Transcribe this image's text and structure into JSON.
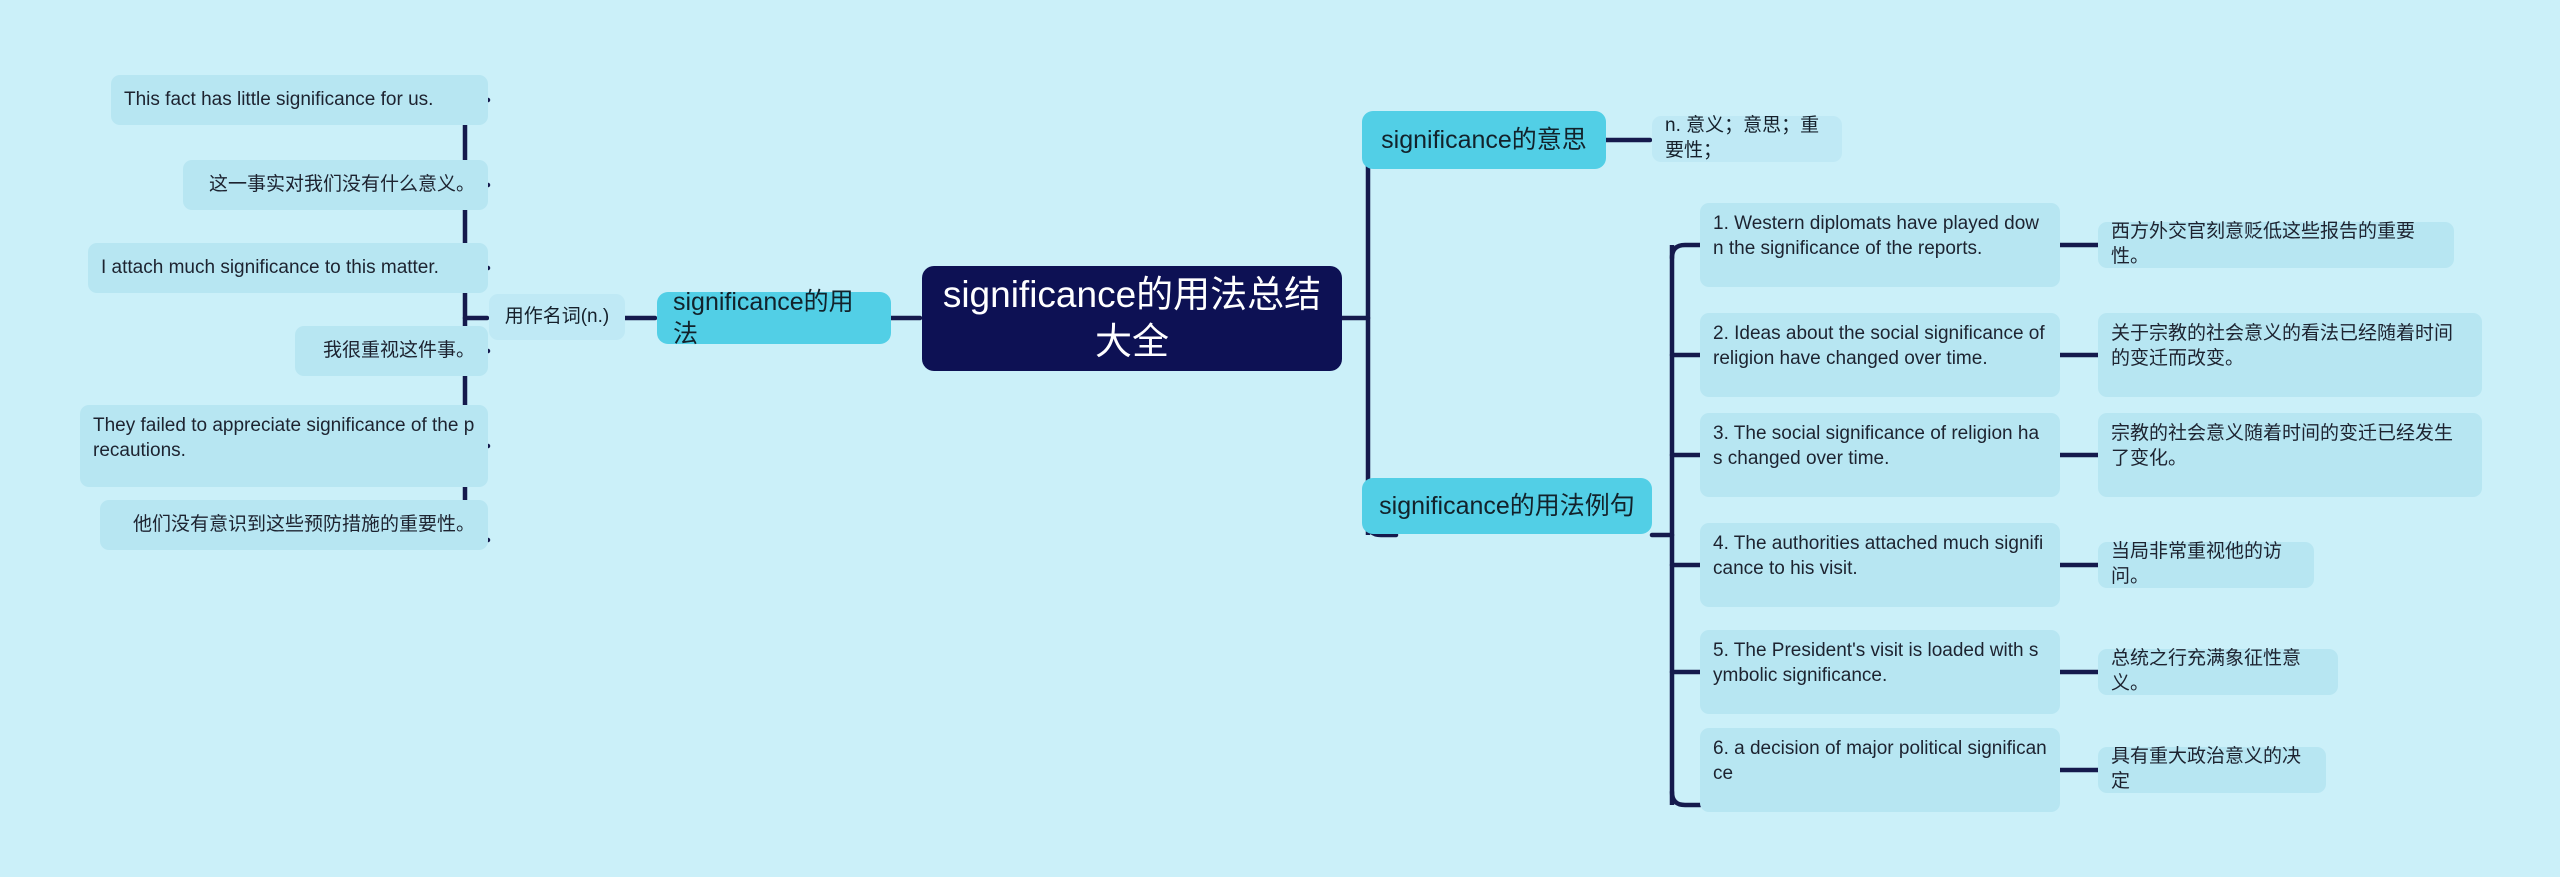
{
  "meta": {
    "background_color": "#cbf0f9",
    "root_color": "#0d1154",
    "branch_color": "#52cfe6",
    "leaf_color": "#b7e6f2",
    "connector_color": "#151a4d"
  },
  "root": {
    "label": "significance的用法总结大全"
  },
  "left": {
    "branch": {
      "label": "significance的用法"
    },
    "sub": {
      "label": "用作名词(n.)"
    },
    "leaves": [
      {
        "label": "This fact has little significance for us."
      },
      {
        "label": "这一事实对我们没有什么意义。"
      },
      {
        "label": "I attach much significance to this matter."
      },
      {
        "label": "我很重视这件事。"
      },
      {
        "label": "They failed to appreciate significance of the precautions."
      },
      {
        "label": "他们没有意识到这些预防措施的重要性。"
      }
    ]
  },
  "right": {
    "meaning": {
      "branch": {
        "label": "significance的意思"
      },
      "definition": {
        "label": "n. 意义；意思；重要性；"
      }
    },
    "examples": {
      "branch": {
        "label": "significance的用法例句"
      },
      "items": [
        {
          "en": "1. Western diplomats have played down the significance of the reports.",
          "cn": "西方外交官刻意贬低这些报告的重要性。"
        },
        {
          "en": "2. Ideas about the social significance of religion have changed over time.",
          "cn": "关于宗教的社会意义的看法已经随着时间的变迁而改变。"
        },
        {
          "en": "3. The social significance of religion has changed over time.",
          "cn": "宗教的社会意义随着时间的变迁已经发生了变化。"
        },
        {
          "en": "4. The authorities attached much significance to his visit.",
          "cn": "当局非常重视他的访问。"
        },
        {
          "en": "5. The President's visit is loaded with symbolic significance.",
          "cn": "总统之行充满象征性意义。"
        },
        {
          "en": "6. a decision of major political significance",
          "cn": "具有重大政治意义的决定"
        }
      ]
    }
  }
}
